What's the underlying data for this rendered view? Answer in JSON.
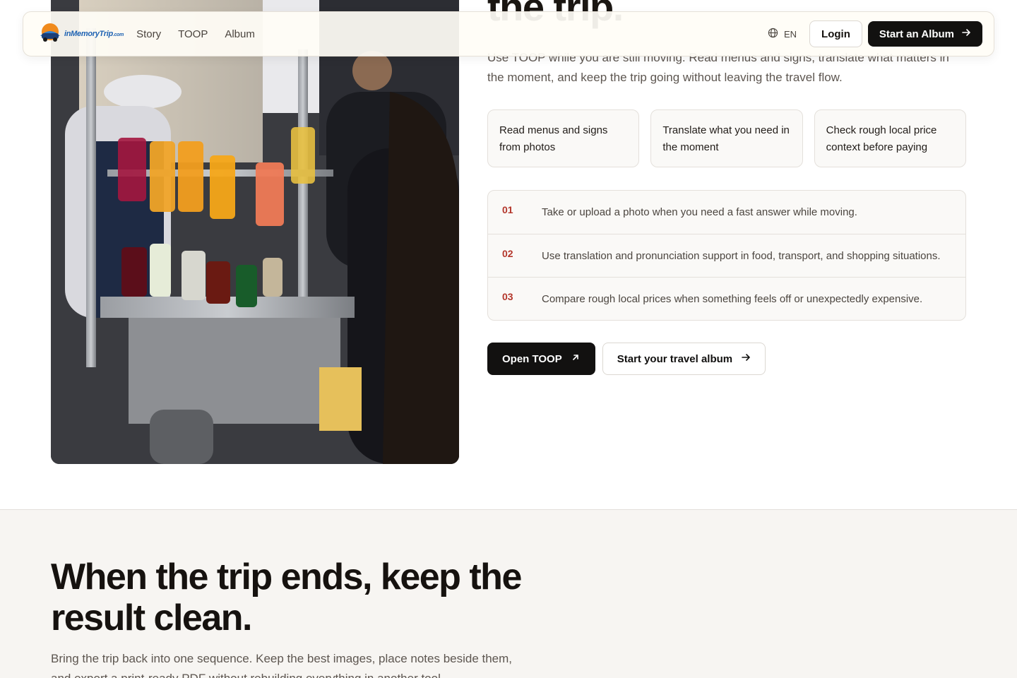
{
  "nav": {
    "logo_text": "inMemoryTrip",
    "logo_suffix": ".com",
    "links": [
      "Story",
      "TOOP",
      "Album"
    ],
    "language": "EN",
    "login_label": "Login",
    "cta_label": "Start an Album"
  },
  "hero": {
    "heading_visible_tail": "the trip.",
    "intro": "Use TOOP while you are still moving. Read menus and signs, translate what matters in the moment, and keep the trip going without leaving the travel flow.",
    "feature_cards": [
      "Read menus and signs from photos",
      "Translate what you need in the moment",
      "Check rough local price context before paying"
    ],
    "steps": [
      {
        "num": "01",
        "text": "Take or upload a photo when you need a fast answer while moving."
      },
      {
        "num": "02",
        "text": "Use translation and pronunciation support in food, transport, and shopping situations."
      },
      {
        "num": "03",
        "text": "Compare rough local prices when something feels off or unexpectedly expensive."
      }
    ],
    "primary_cta": "Open TOOP",
    "secondary_cta": "Start your travel album"
  },
  "section_end": {
    "heading": "When the trip ends, keep the result clean.",
    "body": "Bring the trip back into one sequence. Keep the best images, place notes beside them, and export a print-ready PDF without rebuilding everything in another tool."
  },
  "icons": {
    "logo": "car-logo-icon",
    "language": "globe-icon",
    "cta_arrow": "arrow-right-icon",
    "external": "arrow-up-right-icon"
  },
  "colors": {
    "primary_dark": "#121110",
    "step_number": "#b3362b",
    "section_bg": "#f7f5f2"
  }
}
